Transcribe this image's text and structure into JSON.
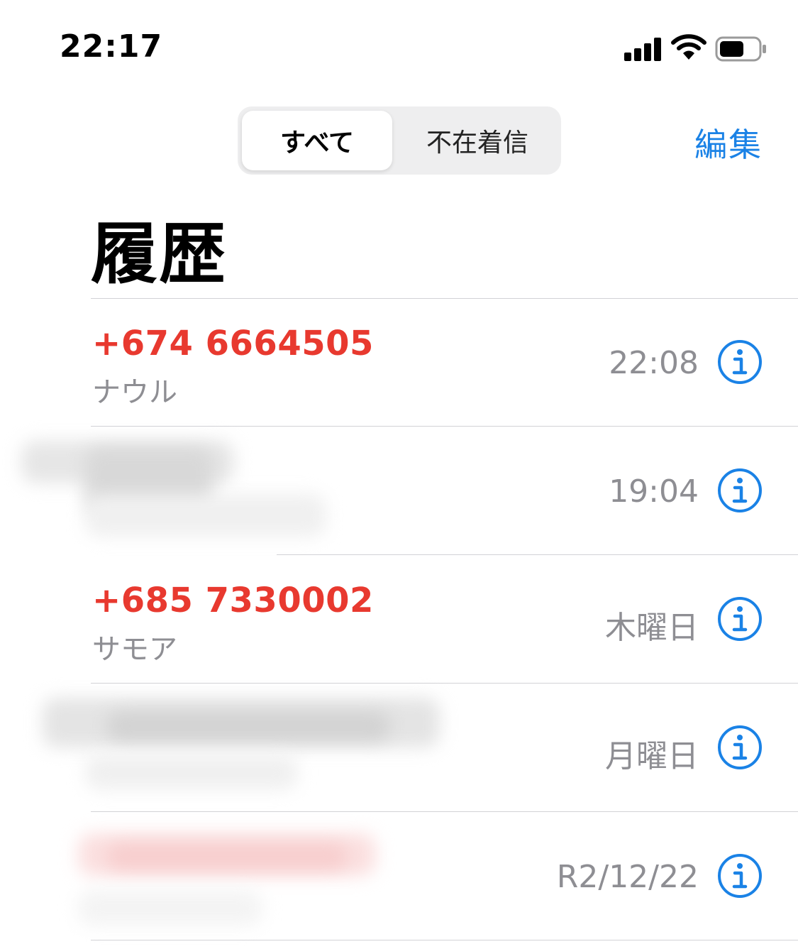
{
  "status_bar": {
    "time": "22:17",
    "icons": [
      "signal-icon",
      "wifi-icon",
      "battery-icon"
    ]
  },
  "nav": {
    "segments": [
      {
        "label": "すべて",
        "selected": true
      },
      {
        "label": "不在着信",
        "selected": false
      }
    ],
    "edit_label": "編集"
  },
  "title": "履歴",
  "colors": {
    "missed": "#e8392f",
    "accent": "#1a82e6",
    "secondary": "#8e8e93"
  },
  "calls": [
    {
      "name": "+674 6664505",
      "subtitle": "ナウル",
      "time": "22:08",
      "missed": true,
      "redacted": false
    },
    {
      "name": "",
      "subtitle": "",
      "time": "19:04",
      "missed": false,
      "redacted": true
    },
    {
      "name": "+685 7330002",
      "subtitle": "サモア",
      "time": "木曜日",
      "missed": true,
      "redacted": false
    },
    {
      "name": "",
      "subtitle": "",
      "time": "月曜日",
      "missed": false,
      "redacted": true
    },
    {
      "name": "",
      "subtitle": "",
      "time": "R2/12/22",
      "missed": true,
      "redacted": true
    }
  ]
}
